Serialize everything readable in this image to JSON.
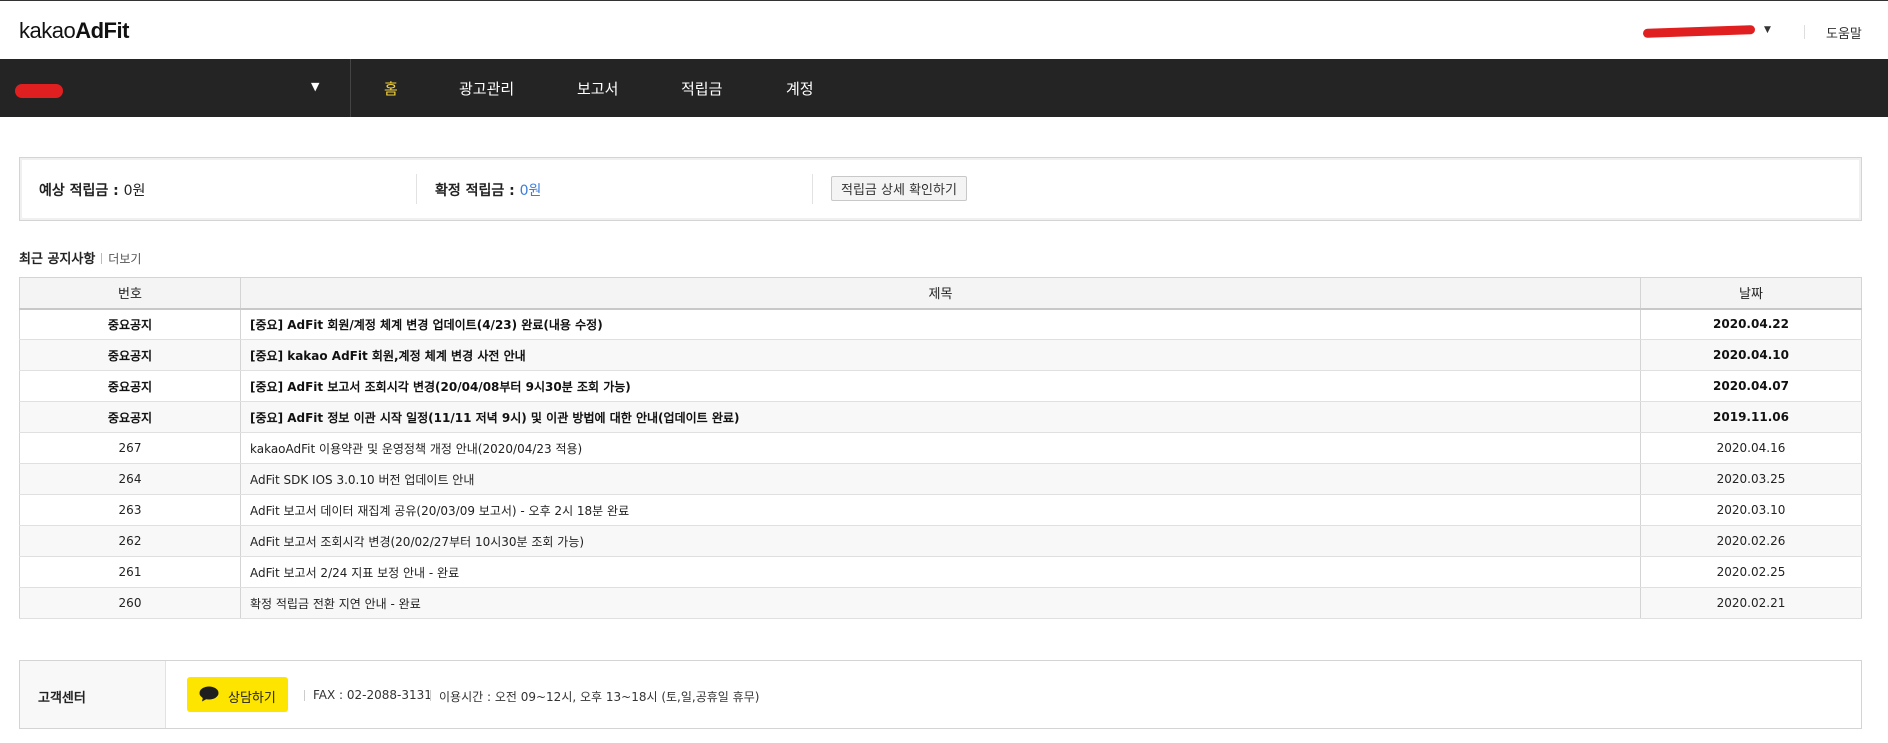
{
  "header": {
    "logo_light": "kakao",
    "logo_bold": "AdFit",
    "help": "도움말"
  },
  "nav": {
    "items": [
      "홈",
      "광고관리",
      "보고서",
      "적립금",
      "계정"
    ],
    "active_index": 0
  },
  "summary": {
    "expected_label": "예상 적립금 : ",
    "expected_value": "0원",
    "confirmed_label": "확정 적립금 : ",
    "confirmed_value": "0원",
    "detail_button": "적립금 상세 확인하기"
  },
  "notices": {
    "title": "최근 공지사항",
    "more": "더보기",
    "columns": {
      "no": "번호",
      "title": "제목",
      "date": "날짜"
    },
    "rows": [
      {
        "no": "중요공지",
        "title": "[중요] AdFit 회원/계정 체계 변경 업데이트(4/23) 완료(내용 수정)",
        "date": "2020.04.22",
        "important": true
      },
      {
        "no": "중요공지",
        "title": "[중요] kakao AdFit 회원,계정 체계 변경 사전 안내",
        "date": "2020.04.10",
        "important": true
      },
      {
        "no": "중요공지",
        "title": "[중요] AdFit 보고서 조회시각 변경(20/04/08부터 9시30분 조회 가능)",
        "date": "2020.04.07",
        "important": true
      },
      {
        "no": "중요공지",
        "title": "[중요] AdFit 정보 이관 시작 일정(11/11 저녁 9시) 및 이관 방법에 대한 안내(업데이트 완료)",
        "date": "2019.11.06",
        "important": true
      },
      {
        "no": "267",
        "title": "kakaoAdFit 이용약관 및 운영정책 개정 안내(2020/04/23 적용)",
        "date": "2020.04.16",
        "important": false
      },
      {
        "no": "264",
        "title": "AdFit SDK IOS 3.0.10 버전 업데이트 안내",
        "date": "2020.03.25",
        "important": false
      },
      {
        "no": "263",
        "title": "AdFit 보고서 데이터 재집계 공유(20/03/09 보고서) - 오후 2시 18분 완료",
        "date": "2020.03.10",
        "important": false
      },
      {
        "no": "262",
        "title": "AdFit 보고서 조회시각 변경(20/02/27부터 10시30분 조회 가능)",
        "date": "2020.02.26",
        "important": false
      },
      {
        "no": "261",
        "title": "AdFit 보고서 2/24 지표 보정 안내 - 완료",
        "date": "2020.02.25",
        "important": false
      },
      {
        "no": "260",
        "title": "확정 적립금 전환 지연 안내 - 완료",
        "date": "2020.02.21",
        "important": false
      }
    ]
  },
  "customer_center": {
    "label": "고객센터",
    "consult_button": "상담하기",
    "fax": "FAX : 02-2088-3131",
    "hours": "이용시간 : 오전 09~12시, 오후 13~18시 (토,일,공휴일 휴무)"
  },
  "colors": {
    "nav_bg": "#242424",
    "nav_active": "#f5d33b",
    "accent_blue": "#3b7ddd",
    "kakao_yellow": "#fee500"
  }
}
